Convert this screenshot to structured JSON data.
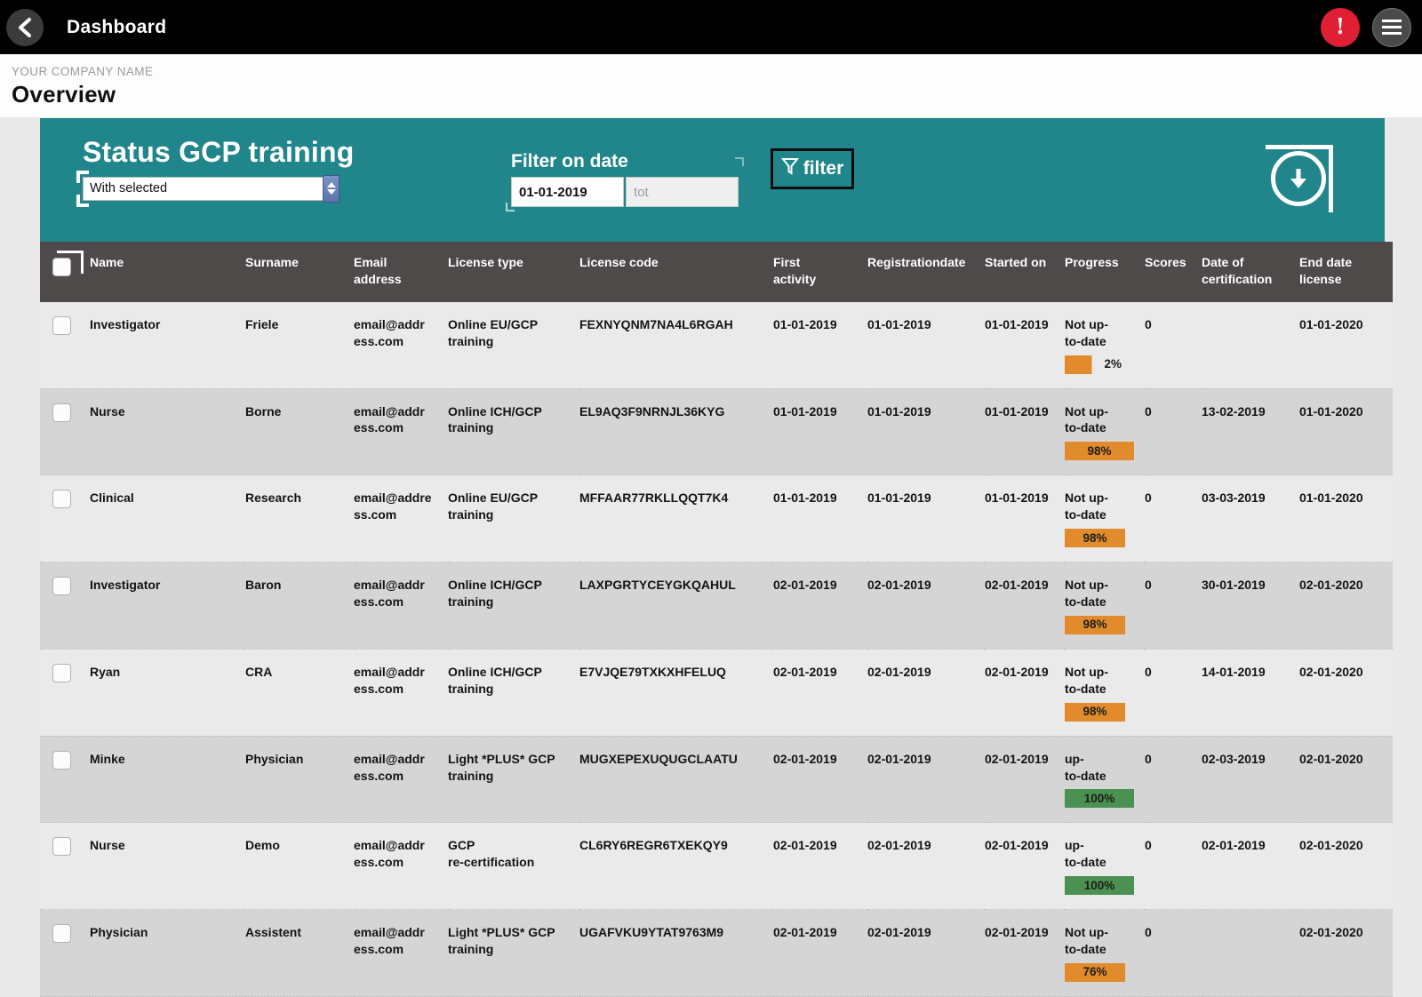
{
  "topbar": {
    "back_icon": "chevron-left-icon",
    "title": "Dashboard",
    "alert_icon": "exclamation-icon",
    "alert_glyph": "!",
    "menu_icon": "hamburger-menu-icon"
  },
  "pagehead": {
    "company": "YOUR COMPANY NAME",
    "title": "Overview"
  },
  "panel": {
    "heading": "Status GCP training",
    "bulk_select_value": "With selected",
    "filter_label": "Filter on date",
    "date_from_value": "01-01-2019",
    "date_to_placeholder": "tot",
    "date_to_value": "",
    "filter_button": "filter",
    "filter_icon": "funnel-icon",
    "download_icon": "download-circle-icon",
    "teal_color": "#21868b",
    "header_color": "#4d4a49",
    "orange_color": "#e28b2d",
    "green_color": "#4b9151"
  },
  "table": {
    "columns": [
      "Name",
      "Surname",
      "Email address",
      "License type",
      "License code",
      "First activity",
      "Registrationdate",
      "Started on",
      "Progress",
      "Scores",
      "Date of certification",
      "End date license"
    ],
    "columns_wrapped": [
      "Name",
      "Surname",
      "Email\naddress",
      "License type",
      "License code",
      "First\nactivity",
      "Registrationdate",
      "Started on",
      "Progress",
      "Scores",
      "Date of\ncertification",
      "End date\nlicense"
    ],
    "rows": [
      {
        "name": "Investigator",
        "surname": "Friele",
        "email_line1": "email@addr",
        "email_line2": "ess.com",
        "license_line1": "Online EU/GCP",
        "license_line2": "training",
        "code": "FEXNYQNM7NA4L6RGAH",
        "first_activity": "01-01-2019",
        "registration": "01-01-2019",
        "started": "01-01-2019",
        "status_line1": "Not up-",
        "status_line2": "to-date",
        "progress": "2%",
        "progress_class": "partial",
        "scores": "0",
        "cert_date": "",
        "end_date": "01-01-2020"
      },
      {
        "name": "Nurse",
        "surname": "Borne",
        "email_line1": "email@addr",
        "email_line2": "ess.com",
        "license_line1": "Online ICH/GCP",
        "license_line2": "training",
        "code": "EL9AQ3F9NRNJL36KYG",
        "first_activity": "01-01-2019",
        "registration": "01-01-2019",
        "started": "01-01-2019",
        "status_line1": "Not up-",
        "status_line2": "to-date",
        "progress": "98%",
        "progress_class": "orange wide",
        "scores": "0",
        "cert_date": "13-02-2019",
        "end_date": "01-01-2020"
      },
      {
        "name": "Clinical",
        "surname": "Research",
        "email_line1": "email@addre",
        "email_line2": "ss.com",
        "license_line1": "Online EU/GCP",
        "license_line2": "training",
        "code": "MFFAAR77RKLLQQT7K4",
        "first_activity": "01-01-2019",
        "registration": "01-01-2019",
        "started": "01-01-2019",
        "status_line1": "Not up-",
        "status_line2": "to-date",
        "progress": "98%",
        "progress_class": "orange",
        "scores": "0",
        "cert_date": "03-03-2019",
        "end_date": "01-01-2020"
      },
      {
        "name": "Investigator",
        "surname": "Baron",
        "email_line1": "email@addr",
        "email_line2": "ess.com",
        "license_line1": "Online ICH/GCP",
        "license_line2": "training",
        "code": "LAXPGRTYCEYGKQAHUL",
        "first_activity": "02-01-2019",
        "registration": "02-01-2019",
        "started": "02-01-2019",
        "status_line1": "Not up-",
        "status_line2": "to-date",
        "progress": "98%",
        "progress_class": "orange",
        "scores": "0",
        "cert_date": "30-01-2019",
        "end_date": "02-01-2020"
      },
      {
        "name": "Ryan",
        "surname": "CRA",
        "email_line1": "email@addr",
        "email_line2": "ess.com",
        "license_line1": "Online ICH/GCP",
        "license_line2": "training",
        "code": "E7VJQE79TXKXHFELUQ",
        "first_activity": "02-01-2019",
        "registration": "02-01-2019",
        "started": "02-01-2019",
        "status_line1": "Not up-",
        "status_line2": "to-date",
        "progress": "98%",
        "progress_class": "orange",
        "scores": "0",
        "cert_date": "14-01-2019",
        "end_date": "02-01-2020"
      },
      {
        "name": "Minke",
        "surname": "Physician",
        "email_line1": "email@addr",
        "email_line2": "ess.com",
        "license_line1": "Light *PLUS* GCP",
        "license_line2": "training",
        "code": "MUGXEPEXUQUGCLAATU",
        "first_activity": "02-01-2019",
        "registration": "02-01-2019",
        "started": "02-01-2019",
        "status_line1": "up-",
        "status_line2": "to-date",
        "progress": "100%",
        "progress_class": "green wide",
        "scores": "0",
        "cert_date": "02-03-2019",
        "end_date": "02-01-2020"
      },
      {
        "name": "Nurse",
        "surname": "Demo",
        "email_line1": "email@addr",
        "email_line2": "ess.com",
        "license_line1": "GCP",
        "license_line2": "re-certification",
        "code": "CL6RY6REGR6TXEKQY9",
        "first_activity": "02-01-2019",
        "registration": "02-01-2019",
        "started": "02-01-2019",
        "status_line1": "up-",
        "status_line2": "to-date",
        "progress": "100%",
        "progress_class": "green wide",
        "scores": "0",
        "cert_date": "02-01-2019",
        "end_date": "02-01-2020"
      },
      {
        "name": "Physician",
        "surname": "Assistent",
        "email_line1": "email@addr",
        "email_line2": "ess.com",
        "license_line1": "Light *PLUS* GCP",
        "license_line2": "training",
        "code": "UGAFVKU9YTAT9763M9",
        "first_activity": "02-01-2019",
        "registration": "02-01-2019",
        "started": "02-01-2019",
        "status_line1": "Not up-",
        "status_line2": "to-date",
        "progress": "76%",
        "progress_class": "orange",
        "scores": "0",
        "cert_date": "",
        "end_date": "02-01-2020"
      }
    ]
  }
}
